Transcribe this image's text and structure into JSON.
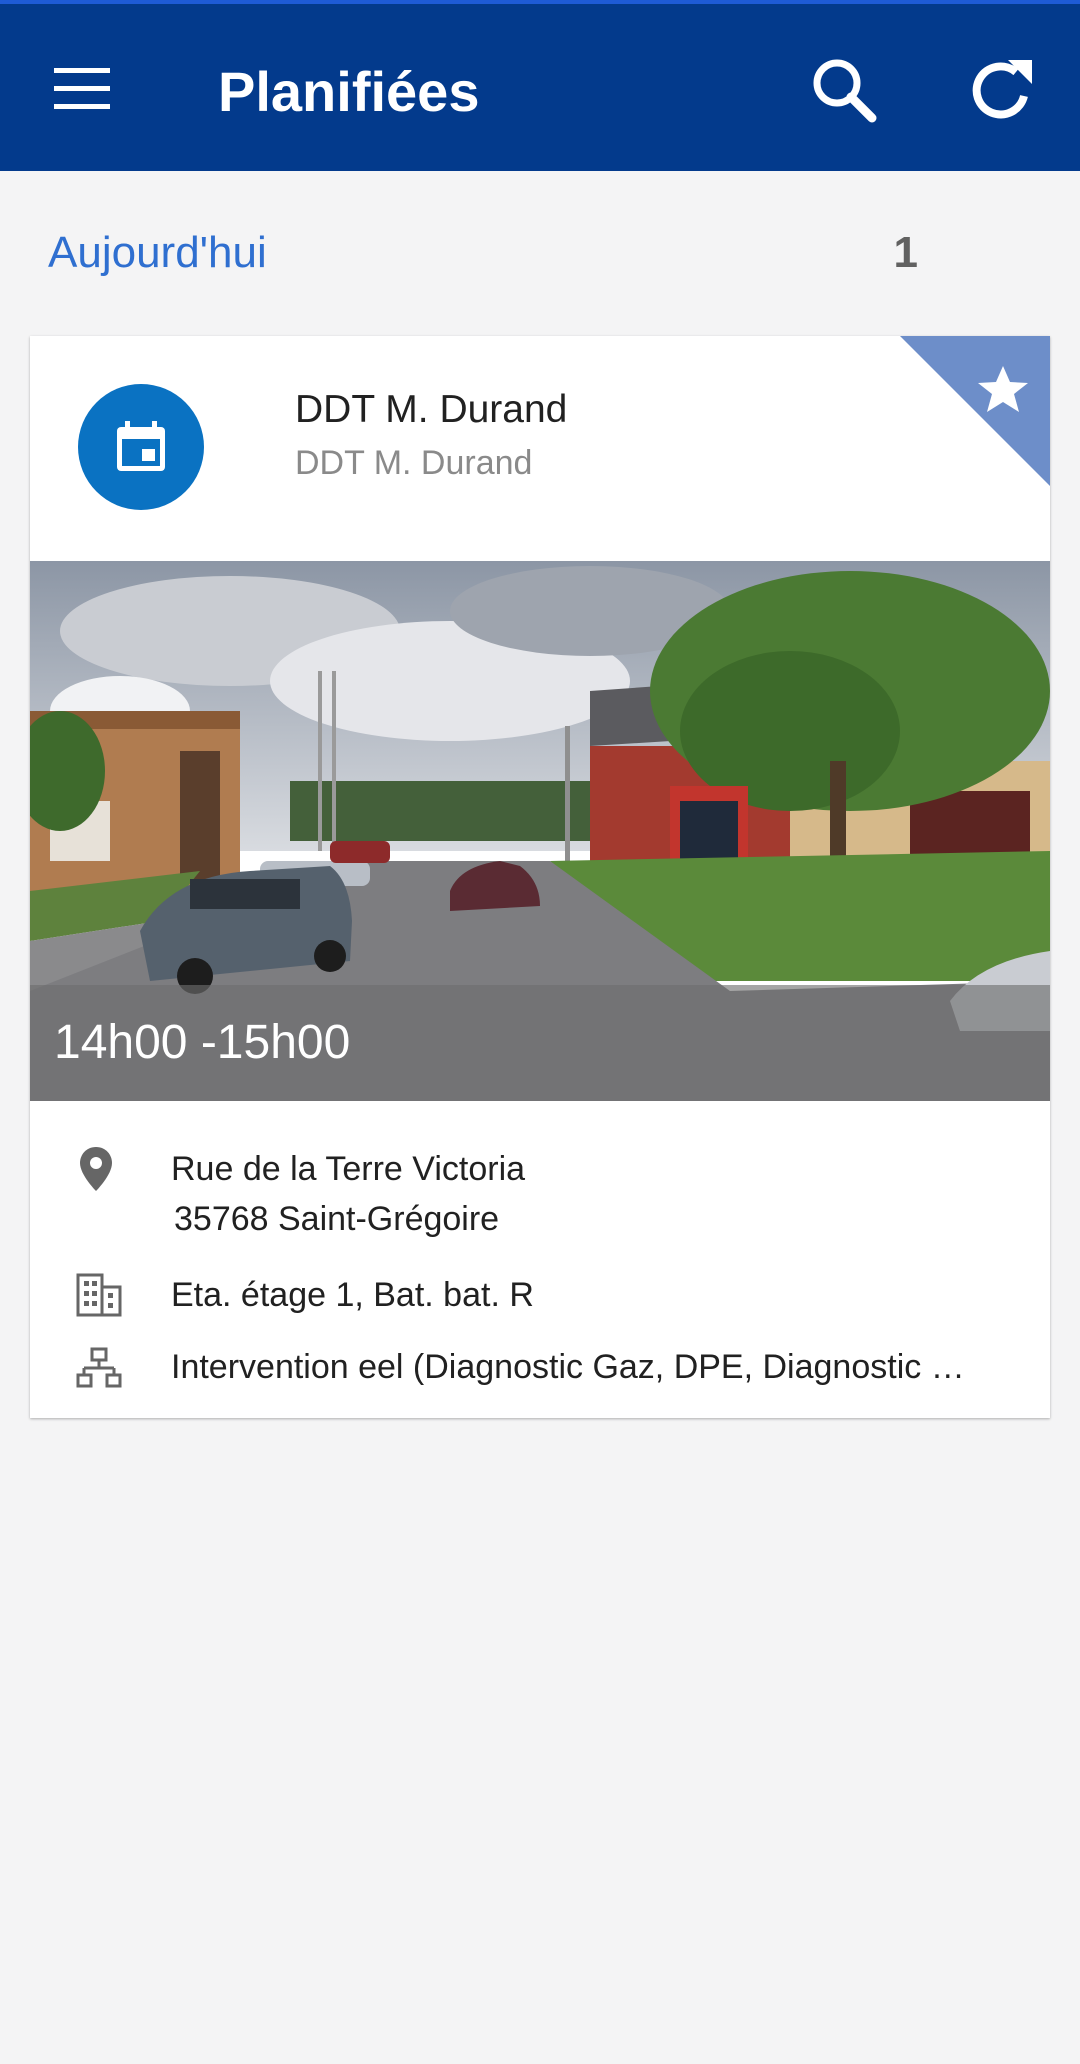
{
  "appbar": {
    "title": "Planifiées",
    "menu_icon": "menu-icon",
    "search_icon": "search-icon",
    "refresh_icon": "refresh-icon",
    "background": "#033a8c"
  },
  "section": {
    "label": "Aujourd'hui",
    "count": "1"
  },
  "card": {
    "title": "DDT M. Durand",
    "subtitle": "DDT M. Durand",
    "avatar_icon": "calendar-icon",
    "favorite_icon": "star-icon",
    "time": "14h00 -15h00",
    "address_line1": "Rue de la Terre Victoria",
    "address_line2": "35768 Saint-Grégoire",
    "building": "Eta. étage 1, Bat. bat. R",
    "intervention": "Intervention eel (Diagnostic Gaz, DPE, Diagnostic …",
    "accent": "#0a72c2"
  }
}
